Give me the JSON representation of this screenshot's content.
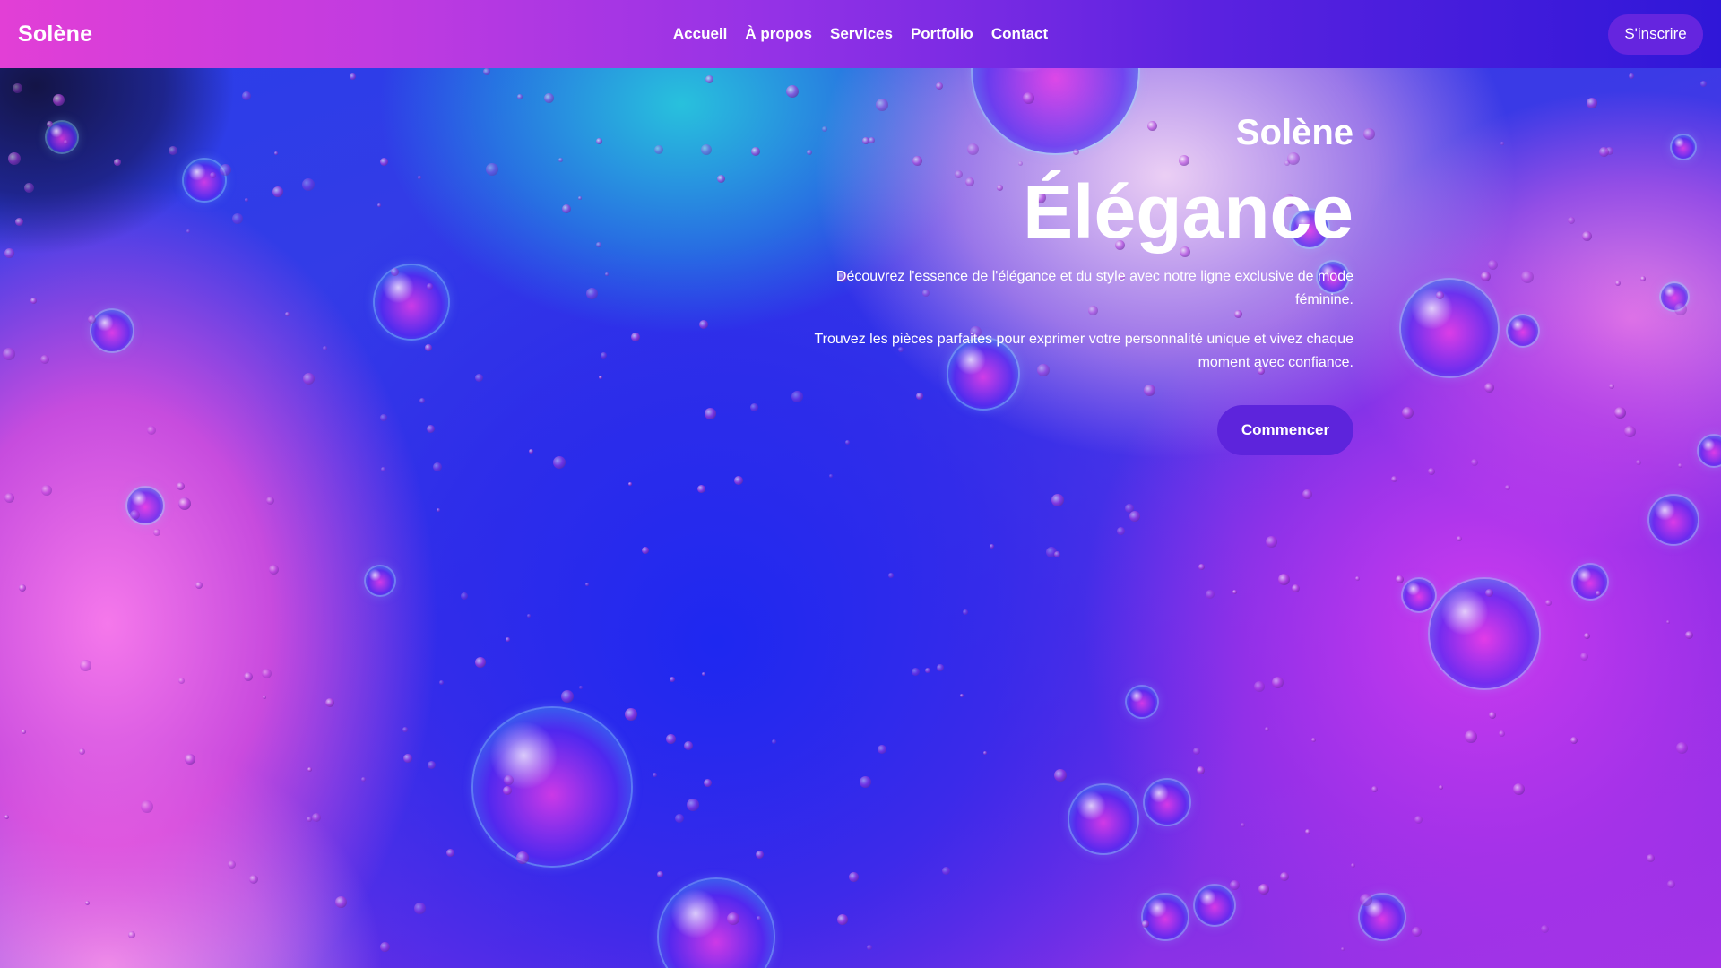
{
  "navbar": {
    "brand": "Solène",
    "links": [
      "Accueil",
      "À propos",
      "Services",
      "Portfolio",
      "Contact"
    ],
    "cta": "S'inscrire"
  },
  "hero": {
    "brand": "Solène",
    "title": "Élégance",
    "paragraph_1": "Découvrez l'essence de l'élégance et du style avec notre ligne exclusive de mode féminine.",
    "paragraph_2": "Trouvez les pièces parfaites pour exprimer votre personnalité unique et vivez chaque moment avec confiance.",
    "button": "Commencer"
  },
  "colors": {
    "accent_button": "#5d24dc",
    "nav_gradient_start": "#e23fd6",
    "nav_gradient_end": "#2f17d8",
    "text": "#ffffff"
  },
  "background": {
    "image": "abstract-bubbles-gradient"
  }
}
